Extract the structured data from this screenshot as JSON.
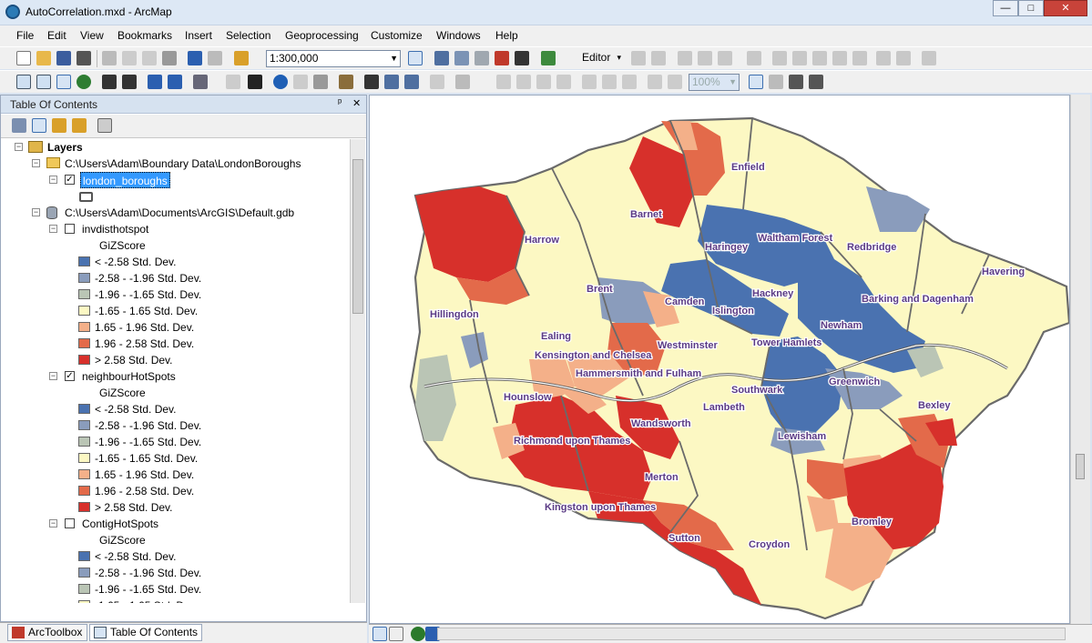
{
  "window": {
    "title": "AutoCorrelation.mxd - ArcMap",
    "minimize": "—",
    "maximize": "□",
    "close": "✕"
  },
  "menu": [
    "File",
    "Edit",
    "View",
    "Bookmarks",
    "Insert",
    "Selection",
    "Geoprocessing",
    "Customize",
    "Windows",
    "Help"
  ],
  "toolbar": {
    "scale": "1:300,000",
    "editor": "Editor",
    "zoom_percent": "100%"
  },
  "toc": {
    "title": "Table Of Contents",
    "pin": "ᵖ",
    "close": "✕",
    "root": "Layers",
    "folder1": "C:\\Users\\Adam\\Boundary Data\\LondonBoroughs",
    "layer_london": "london_boroughs",
    "gdb": "C:\\Users\\Adam\\Documents\\ArcGIS\\Default.gdb",
    "field": "GiZScore",
    "layers": [
      {
        "name": "invdisthotspot",
        "checked": false
      },
      {
        "name": "neighbourHotSpots",
        "checked": true
      },
      {
        "name": "ContigHotSpots",
        "checked": false
      }
    ],
    "classes": [
      "< -2.58 Std. Dev.",
      "-2.58 - -1.96 Std. Dev.",
      "-1.96 - -1.65 Std. Dev.",
      "-1.65 - 1.65 Std. Dev.",
      "1.65 - 1.96 Std. Dev.",
      "1.96 - 2.58 Std. Dev.",
      "> 2.58 Std. Dev."
    ],
    "class_colors": [
      "#4a72b0",
      "#8a9cbc",
      "#bac5b5",
      "#fcf8c3",
      "#f4b089",
      "#e36a4a",
      "#d7302b"
    ]
  },
  "bottom_tabs": [
    "ArcToolbox",
    "Table Of Contents"
  ],
  "map": {
    "boroughs": [
      "Enfield",
      "Barnet",
      "Harrow",
      "Haringey",
      "Waltham Forest",
      "Redbridge",
      "Havering",
      "Brent",
      "Camden",
      "Hackney",
      "Islington",
      "Barking and Dagenham",
      "Hillingdon",
      "Ealing",
      "Newham",
      "Kensington and Chelsea",
      "Westminster",
      "Tower Hamlets",
      "Hammersmith and Fulham",
      "Greenwich",
      "Hounslow",
      "Southwark",
      "Lambeth",
      "Bexley",
      "Wandsworth",
      "Lewisham",
      "Richmond upon Thames",
      "Merton",
      "Kingston upon Thames",
      "Bromley",
      "Sutton",
      "Croydon"
    ]
  }
}
